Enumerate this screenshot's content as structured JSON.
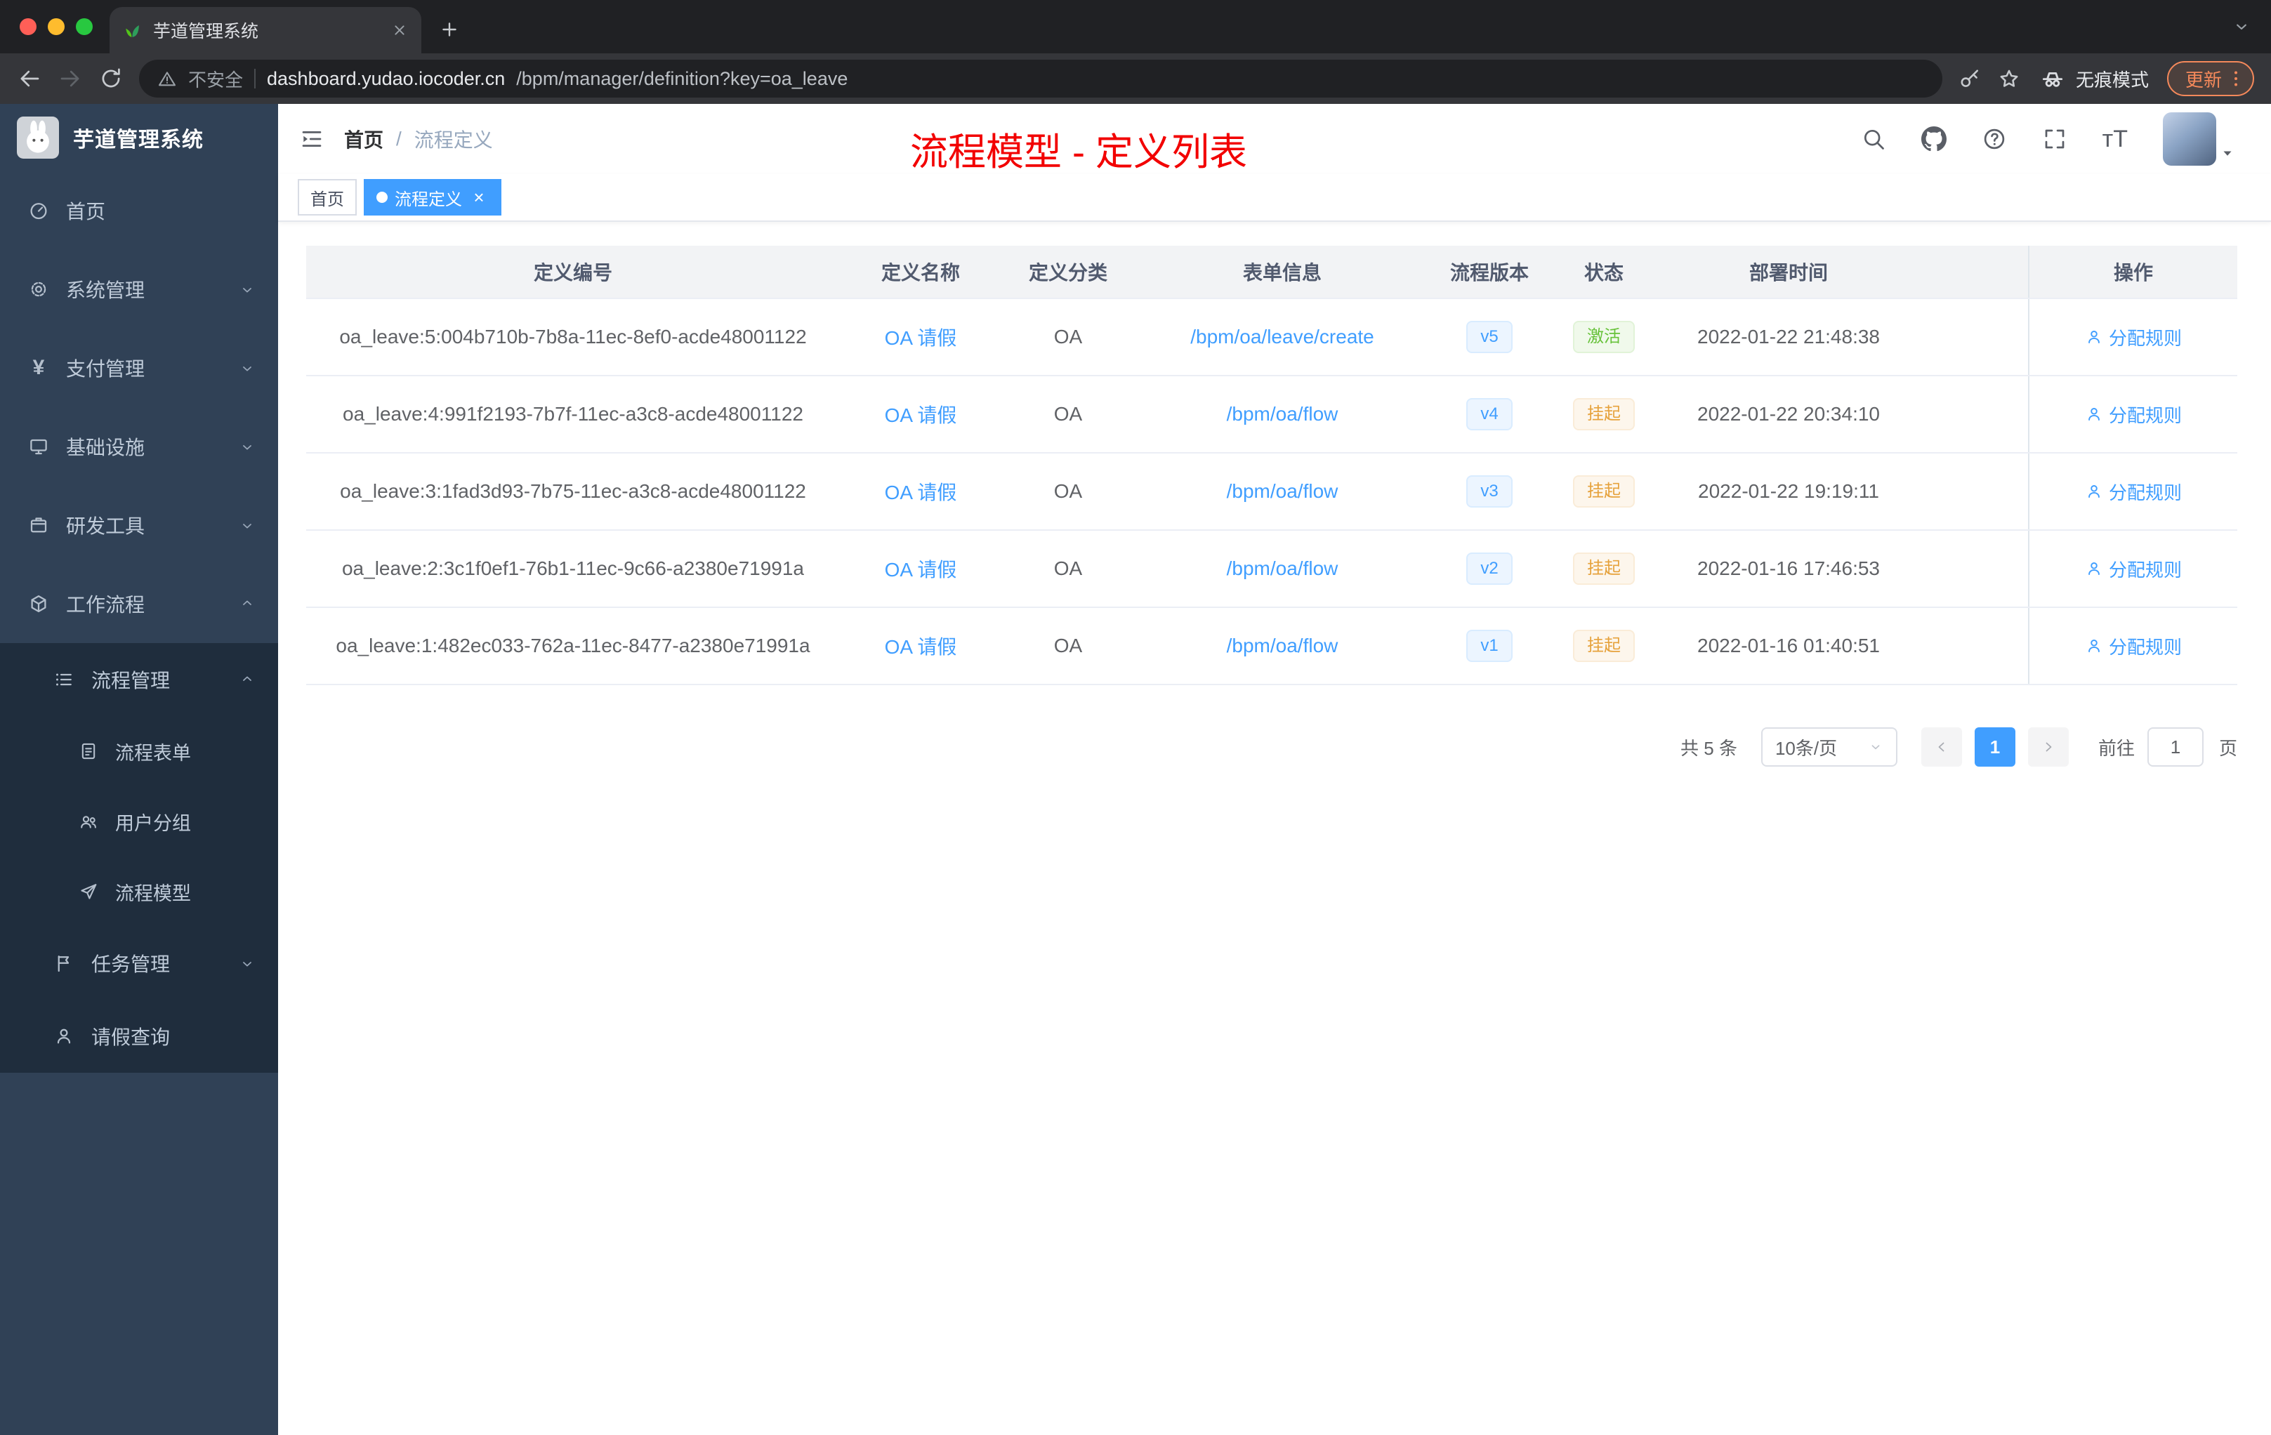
{
  "colors": {
    "accent": "#409eff",
    "sidebar_bg": "#304156",
    "sidebar_submenu_bg": "#1f2d3d",
    "success": "#67c23a",
    "warning": "#e6a23c",
    "annotation_red": "#f20000"
  },
  "browser": {
    "tab_title": "芋道管理系统",
    "security_label": "不安全",
    "url_domain": "dashboard.yudao.iocoder.cn",
    "url_path": "/bpm/manager/definition?key=oa_leave",
    "incognito_label": "无痕模式",
    "update_label": "更新"
  },
  "sidebar": {
    "logo_title": "芋道管理系统",
    "items": [
      {
        "key": "home",
        "label": "首页",
        "icon": "gauge",
        "level": 1
      },
      {
        "key": "system-management",
        "label": "系统管理",
        "icon": "gear",
        "level": 1,
        "chevron": "down"
      },
      {
        "key": "payment-management",
        "label": "支付管理",
        "icon": "yen",
        "level": 1,
        "chevron": "down"
      },
      {
        "key": "infrastructure",
        "label": "基础设施",
        "icon": "monitor",
        "level": 1,
        "chevron": "down"
      },
      {
        "key": "dev-tools",
        "label": "研发工具",
        "icon": "box",
        "level": 1,
        "chevron": "down"
      },
      {
        "key": "workflow",
        "label": "工作流程",
        "icon": "cube",
        "level": 1,
        "chevron": "up"
      },
      {
        "key": "process-management",
        "label": "流程管理",
        "icon": "list",
        "level": 2,
        "chevron": "up",
        "dark": true
      },
      {
        "key": "process-form",
        "label": "流程表单",
        "icon": "doc",
        "level": 3,
        "dark": true
      },
      {
        "key": "user-group",
        "label": "用户分组",
        "icon": "people",
        "level": 3,
        "dark": true
      },
      {
        "key": "process-model",
        "label": "流程模型",
        "icon": "plane",
        "level": 3,
        "dark": true
      },
      {
        "key": "task-management",
        "label": "任务管理",
        "icon": "flag",
        "level": 2,
        "chevron": "down",
        "dark": true
      },
      {
        "key": "leave-query",
        "label": "请假查询",
        "icon": "person",
        "level": 2,
        "dark": true
      }
    ]
  },
  "navbar": {
    "breadcrumb": [
      "首页",
      "流程定义"
    ],
    "annotation": "流程模型 - 定义列表"
  },
  "tags": [
    {
      "label": "首页",
      "active": false,
      "closable": false
    },
    {
      "label": "流程定义",
      "active": true,
      "closable": true
    }
  ],
  "table": {
    "columns": [
      {
        "key": "id",
        "label": "定义编号"
      },
      {
        "key": "name",
        "label": "定义名称"
      },
      {
        "key": "category",
        "label": "定义分类"
      },
      {
        "key": "form",
        "label": "表单信息"
      },
      {
        "key": "version",
        "label": "流程版本"
      },
      {
        "key": "status",
        "label": "状态"
      },
      {
        "key": "time",
        "label": "部署时间"
      },
      {
        "key": "op",
        "label": "操作"
      }
    ],
    "rows": [
      {
        "id": "oa_leave:5:004b710b-7b8a-11ec-8ef0-acde48001122",
        "name": "OA 请假",
        "category": "OA",
        "form": "/bpm/oa/leave/create",
        "version": "v5",
        "status": {
          "label": "激活",
          "type": "success"
        },
        "time": "2022-01-22 21:48:38",
        "action": "分配规则"
      },
      {
        "id": "oa_leave:4:991f2193-7b7f-11ec-a3c8-acde48001122",
        "name": "OA 请假",
        "category": "OA",
        "form": "/bpm/oa/flow",
        "version": "v4",
        "status": {
          "label": "挂起",
          "type": "warning"
        },
        "time": "2022-01-22 20:34:10",
        "action": "分配规则"
      },
      {
        "id": "oa_leave:3:1fad3d93-7b75-11ec-a3c8-acde48001122",
        "name": "OA 请假",
        "category": "OA",
        "form": "/bpm/oa/flow",
        "version": "v3",
        "status": {
          "label": "挂起",
          "type": "warning"
        },
        "time": "2022-01-22 19:19:11",
        "action": "分配规则"
      },
      {
        "id": "oa_leave:2:3c1f0ef1-76b1-11ec-9c66-a2380e71991a",
        "name": "OA 请假",
        "category": "OA",
        "form": "/bpm/oa/flow",
        "version": "v2",
        "status": {
          "label": "挂起",
          "type": "warning"
        },
        "time": "2022-01-16 17:46:53",
        "action": "分配规则"
      },
      {
        "id": "oa_leave:1:482ec033-762a-11ec-8477-a2380e71991a",
        "name": "OA 请假",
        "category": "OA",
        "form": "/bpm/oa/flow",
        "version": "v1",
        "status": {
          "label": "挂起",
          "type": "warning"
        },
        "time": "2022-01-16 01:40:51",
        "action": "分配规则"
      }
    ]
  },
  "pagination": {
    "total": "共 5 条",
    "page_size": "10条/页",
    "current_page": "1",
    "goto_label": "前往",
    "goto_value": "1",
    "page_unit": "页"
  }
}
